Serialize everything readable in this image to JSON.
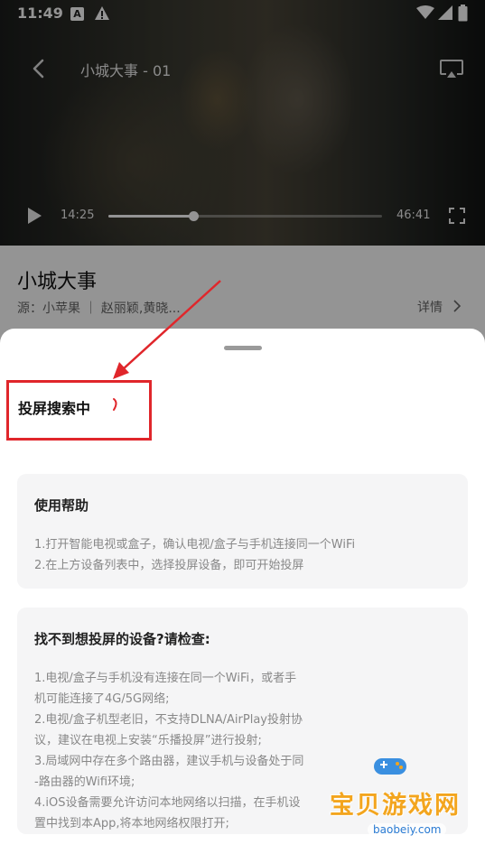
{
  "status_bar": {
    "time": "11:49",
    "notif_letter": "A"
  },
  "player": {
    "title": "小城大事 - 01",
    "current_time": "14:25",
    "total_time": "46:41",
    "progress": 0.31
  },
  "show": {
    "title": "小城大事",
    "meta": "源：小苹果 ｜ 赵丽颖,黄晓...",
    "details_label": "详情"
  },
  "cast_sheet": {
    "status": "投屏搜索中",
    "help": {
      "title": "使用帮助",
      "lines": [
        "1.打开智能电视或盒子，确认电视/盒子与手机连接同一个WiFi",
        "2.在上方设备列表中，选择投屏设备，即可开始投屏"
      ]
    },
    "troubleshoot": {
      "title": "找不到想投屏的设备?请检查:",
      "lines": [
        "1.电视/盒子与手机没有连接在同一个WiFi，或者手",
        "机可能连接了4G/5G网络;",
        "2.电视/盒子机型老旧，不支持DLNA/AirPlay投射协",
        "议，建议在电视上安装“乐播投屏”进行投射;",
        "3.局域网中存在多个路由器，建议手机与设备处于同",
        "-路由器的Wifi环境;",
        "4.iOS设备需要允许访问本地网络以扫描，在手机设",
        "置中找到本App,将本地网络权限打开;"
      ]
    }
  },
  "watermark": {
    "text": "宝贝游戏网",
    "url": "baobeiy.com"
  },
  "colors": {
    "annotation": "#e0262b",
    "spinner": "#e0262b",
    "watermark": "#f3a51e"
  }
}
